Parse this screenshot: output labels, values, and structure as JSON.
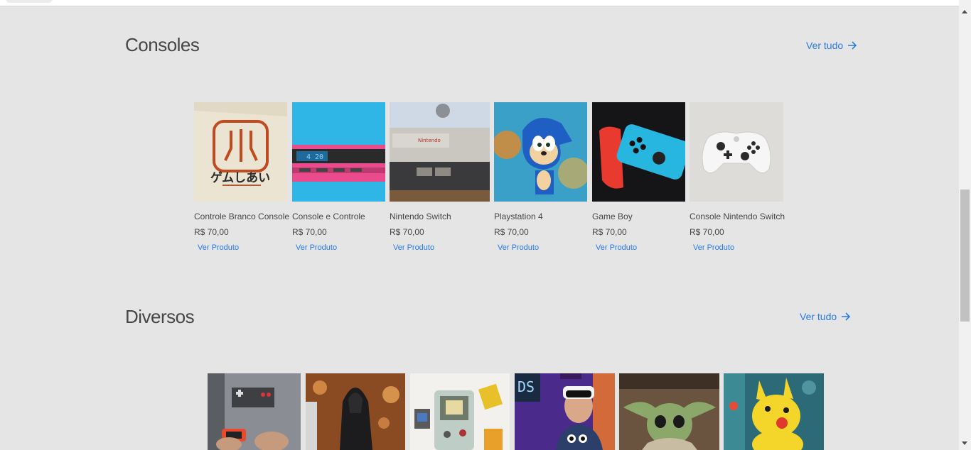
{
  "consoles": {
    "title": "Consoles",
    "see_all": "Ver tudo",
    "products": [
      {
        "name": "Controle Branco Console",
        "price": "R$ 70,00",
        "link": "Ver Produto",
        "image": "atari-shirt-image"
      },
      {
        "name": "Console e Controle",
        "price": "R$ 70,00",
        "link": "Ver Produto",
        "image": "retro-device-image"
      },
      {
        "name": "Nintendo Switch",
        "price": "R$ 70,00",
        "link": "Ver Produto",
        "image": "nes-console-image"
      },
      {
        "name": "Playstation 4",
        "price": "R$ 70,00",
        "link": "Ver Produto",
        "image": "sonic-figure-image"
      },
      {
        "name": "Game Boy",
        "price": "R$ 70,00",
        "link": "Ver Produto",
        "image": "switch-joycon-image"
      },
      {
        "name": "Console Nintendo Switch",
        "price": "R$ 70,00",
        "link": "Ver Produto",
        "image": "xbox-controller-image"
      }
    ]
  },
  "diversos": {
    "title": "Diversos",
    "see_all": "Ver tudo",
    "products": [
      {
        "image": "nes-shirt-player-image"
      },
      {
        "image": "kylo-ren-figure-image"
      },
      {
        "image": "gameboy-cartridges-image"
      },
      {
        "image": "vr-headset-player-image"
      },
      {
        "image": "baby-yoda-image"
      },
      {
        "image": "pikachu-figure-image"
      }
    ]
  },
  "colors": {
    "background": "#e5e5e5",
    "link": "#2a7ae2",
    "text": "#464646"
  }
}
